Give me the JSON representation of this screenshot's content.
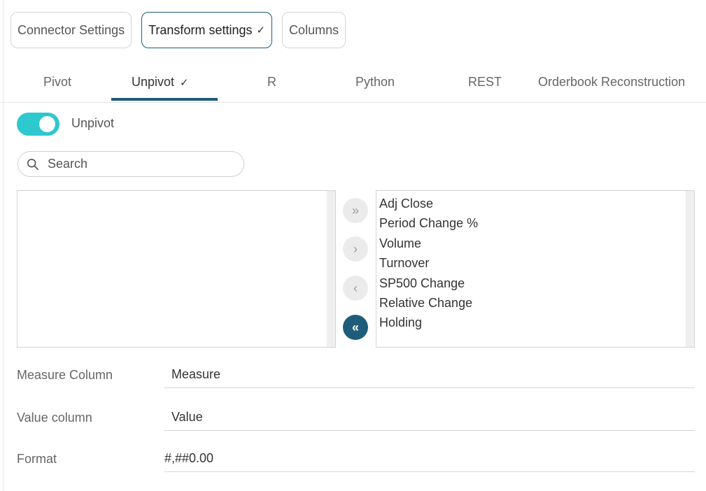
{
  "steps": [
    {
      "label": "Connector Settings",
      "checked": false
    },
    {
      "label": "Transform settings",
      "checked": true
    },
    {
      "label": "Columns",
      "checked": false
    }
  ],
  "tabs": [
    {
      "label": "Pivot"
    },
    {
      "label": "Unpivot",
      "checked": true
    },
    {
      "label": "R"
    },
    {
      "label": "Python"
    },
    {
      "label": "REST"
    },
    {
      "label": "Orderbook Reconstruction"
    }
  ],
  "check_glyph": "✓",
  "unpivot_toggle": {
    "label": "Unpivot",
    "on": true
  },
  "search": {
    "placeholder": "Search",
    "value": ""
  },
  "available_columns": [],
  "selected_columns": [
    "Adj Close",
    "Period Change %",
    "Volume",
    "Turnover",
    "SP500 Change",
    "Relative Change",
    "Holding"
  ],
  "transfer_buttons": {
    "add_all": "»",
    "add": "›",
    "remove": "‹",
    "remove_all": "«"
  },
  "fields": {
    "measure_label": "Measure Column",
    "measure_value": "Measure",
    "value_label": "Value column",
    "value_value": "Value",
    "format_label": "Format",
    "format_value": "#,##0.00"
  },
  "colors": {
    "accent": "#1f5c7a",
    "toggle_on": "#2ec8cf"
  }
}
